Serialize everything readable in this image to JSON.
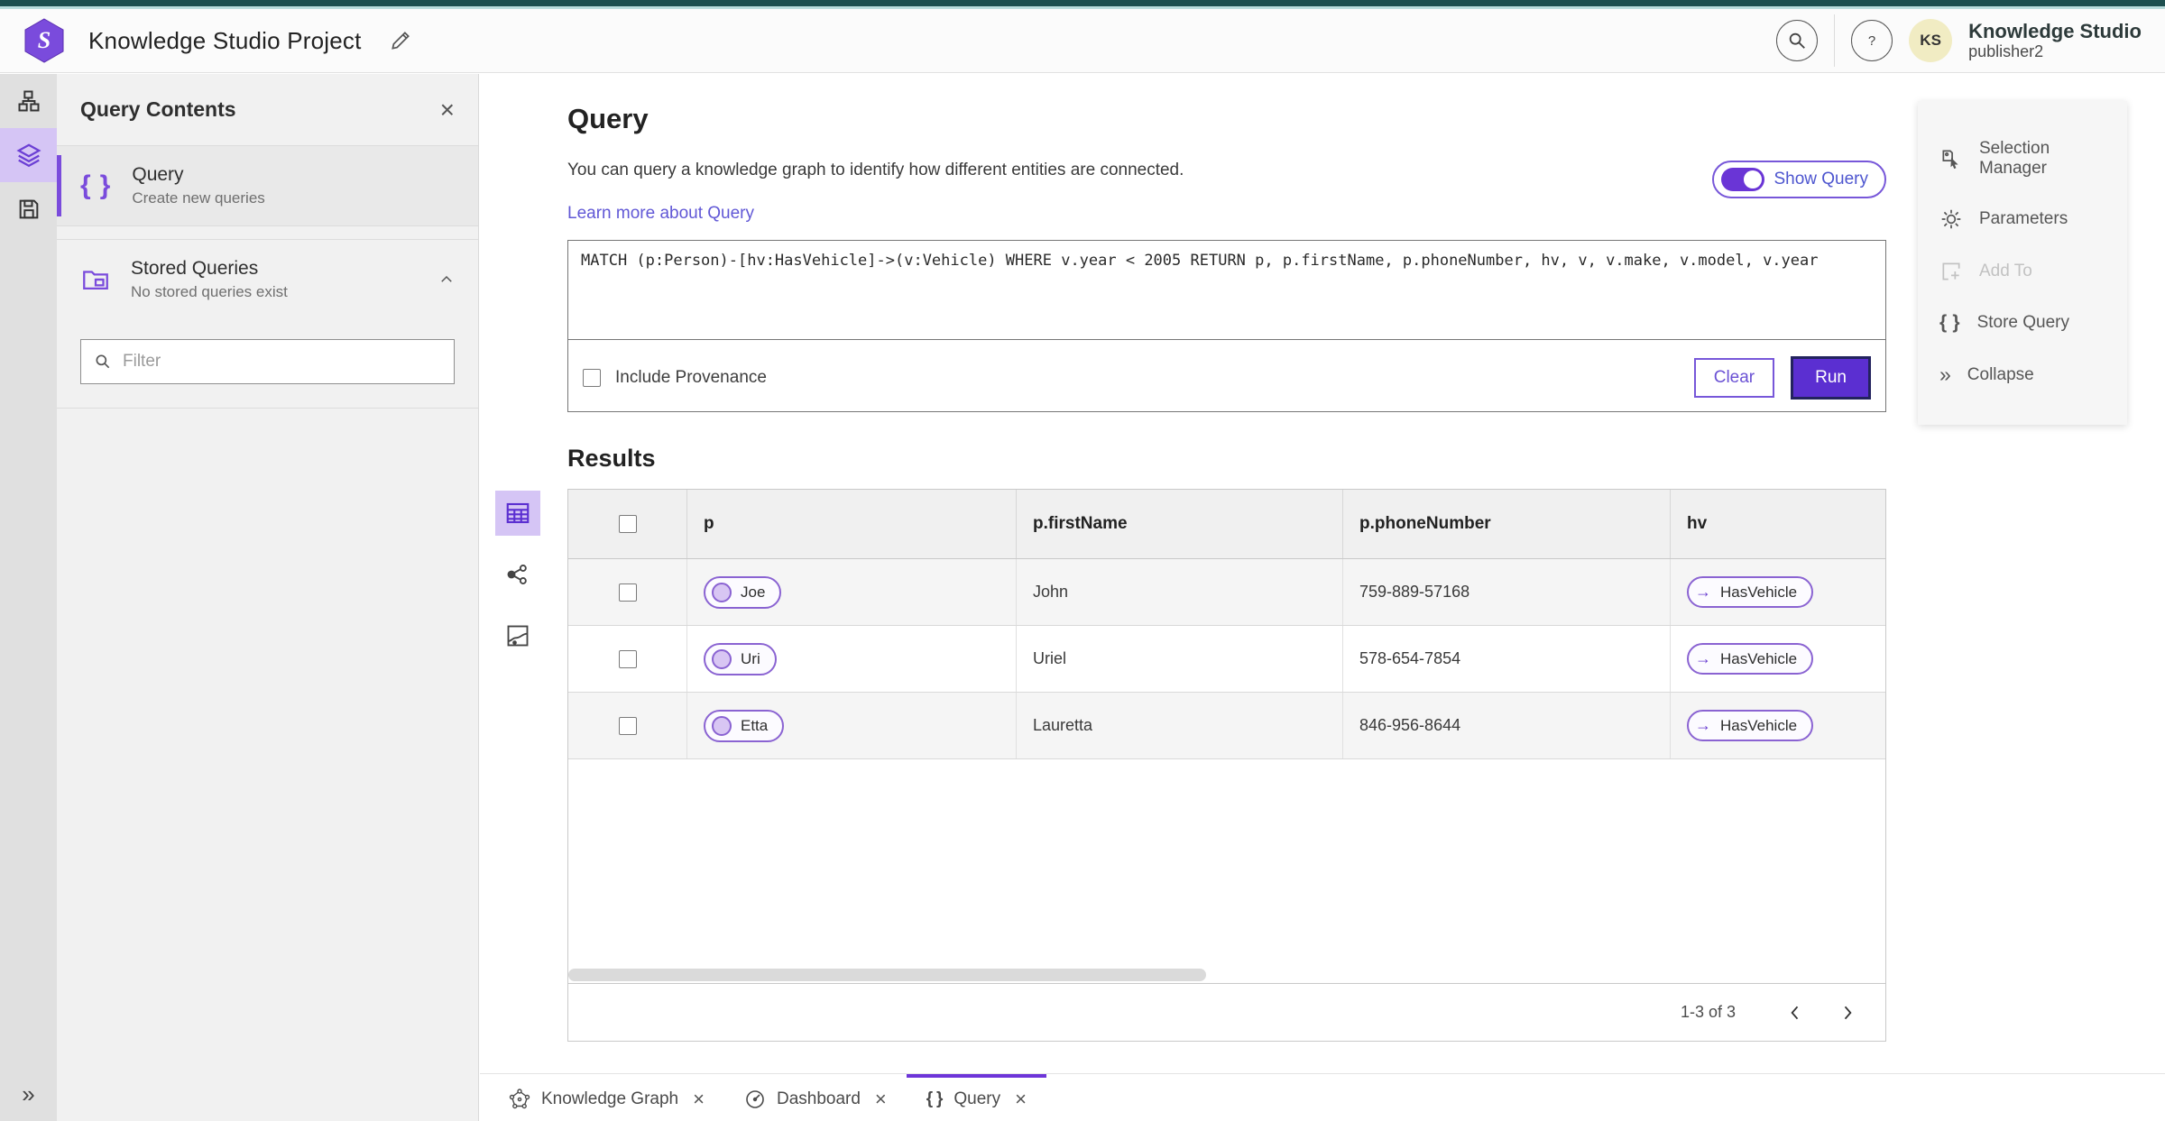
{
  "app": {
    "title": "Knowledge Studio Project",
    "product_name": "Knowledge Studio",
    "user_name": "publisher2",
    "avatar_initials": "KS"
  },
  "panel": {
    "title": "Query Contents",
    "query_item": {
      "title": "Query",
      "subtitle": "Create new queries"
    },
    "stored_item": {
      "title": "Stored Queries",
      "subtitle": "No stored queries exist"
    },
    "filter_placeholder": "Filter"
  },
  "main": {
    "title": "Query",
    "description": "You can query a knowledge graph to identify how different entities are connected.",
    "learn_more": "Learn more about Query",
    "show_query_label": "Show Query",
    "query_text": "MATCH (p:Person)-[hv:HasVehicle]->(v:Vehicle) WHERE v.year < 2005 RETURN p, p.firstName, p.phoneNumber, hv, v, v.make, v.model, v.year",
    "include_provenance_label": "Include Provenance",
    "clear_label": "Clear",
    "run_label": "Run",
    "results_title": "Results"
  },
  "results_table": {
    "columns": [
      "p",
      "p.firstName",
      "p.phoneNumber",
      "hv"
    ],
    "rows": [
      {
        "p": "Joe",
        "firstName": "John",
        "phoneNumber": "759-889-57168",
        "hv": "HasVehicle"
      },
      {
        "p": "Uri",
        "firstName": "Uriel",
        "phoneNumber": "578-654-7854",
        "hv": "HasVehicle"
      },
      {
        "p": "Etta",
        "firstName": "Lauretta",
        "phoneNumber": "846-956-8644",
        "hv": "HasVehicle"
      }
    ],
    "pagination": {
      "range_label": "1-3 of 3"
    }
  },
  "right_panel": {
    "items": [
      {
        "label": "Selection Manager"
      },
      {
        "label": "Parameters"
      },
      {
        "label": "Add To"
      },
      {
        "label": "Store Query"
      },
      {
        "label": "Collapse"
      }
    ]
  },
  "bottom_tabs": [
    {
      "label": "Knowledge Graph"
    },
    {
      "label": "Dashboard"
    },
    {
      "label": "Query"
    }
  ],
  "colors": {
    "accent_purple": "#5b2fd1",
    "accent_outline": "#7757d9",
    "light_purple": "#d5c5f5",
    "link": "#6158d6",
    "top_strip_teal": "#1d4f4f"
  }
}
